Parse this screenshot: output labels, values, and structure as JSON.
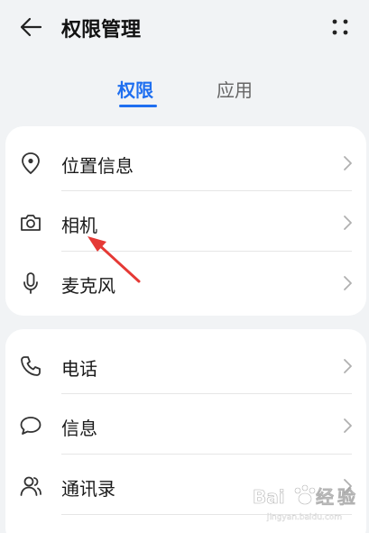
{
  "header": {
    "title": "权限管理",
    "back_icon": "arrow-left-icon",
    "more_icon": "more-dots-icon"
  },
  "tabs": [
    {
      "label": "权限",
      "active": true
    },
    {
      "label": "应用",
      "active": false
    }
  ],
  "colors": {
    "accent": "#1f6ff0",
    "background": "#f1f3f5",
    "card": "#ffffff",
    "annotation": "#e53935"
  },
  "groups": [
    {
      "items": [
        {
          "label": "位置信息",
          "icon": "location-pin-icon"
        },
        {
          "label": "相机",
          "icon": "camera-icon"
        },
        {
          "label": "麦克风",
          "icon": "microphone-icon"
        }
      ]
    },
    {
      "items": [
        {
          "label": "电话",
          "icon": "phone-icon"
        },
        {
          "label": "信息",
          "icon": "message-icon"
        },
        {
          "label": "通讯录",
          "icon": "contacts-icon"
        }
      ]
    }
  ],
  "watermark": {
    "text": "Baidu 经验"
  }
}
